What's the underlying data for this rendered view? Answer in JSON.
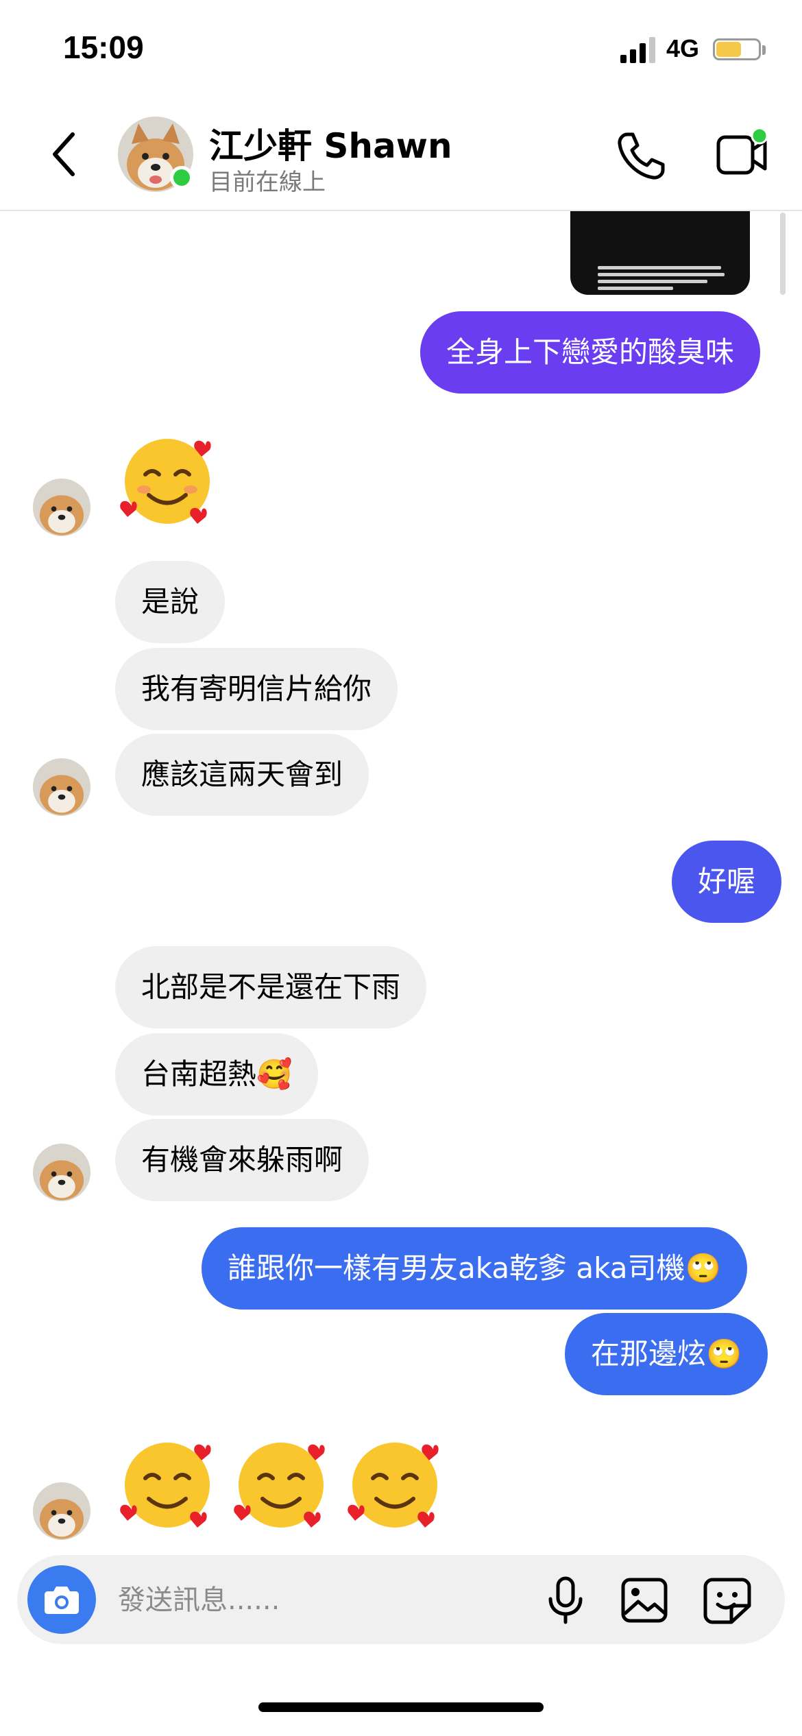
{
  "status_bar": {
    "time": "15:09",
    "network": "4G",
    "battery_color": "#f5c84a"
  },
  "header": {
    "contact_name": "江少軒 Shawn",
    "contact_status": "目前在線上",
    "online_color": "#2ecc40",
    "icons": [
      "chevron-left-icon",
      "phone-icon",
      "video-camera-icon"
    ]
  },
  "messages": [
    {
      "from": "me",
      "type": "image"
    },
    {
      "from": "me",
      "type": "text",
      "text": "全身上下戀愛的酸臭味",
      "color": "#6a3df0"
    },
    {
      "from": "them",
      "type": "emoji",
      "emoji": "🥰"
    },
    {
      "from": "them",
      "type": "text",
      "text": "是說"
    },
    {
      "from": "them",
      "type": "text",
      "text": "我有寄明信片給你"
    },
    {
      "from": "them",
      "type": "text",
      "text": "應該這兩天會到"
    },
    {
      "from": "me",
      "type": "text",
      "text": "好喔",
      "color": "#4a56ee"
    },
    {
      "from": "them",
      "type": "text",
      "text": "北部是不是還在下雨"
    },
    {
      "from": "them",
      "type": "text",
      "text": "台南超熱",
      "emoji": "🥰"
    },
    {
      "from": "them",
      "type": "text",
      "text": "有機會來躲雨啊"
    },
    {
      "from": "me",
      "type": "text",
      "text": "誰跟你一樣有男友aka乾爹 aka司機",
      "emoji": "🙄",
      "color": "#3a6df0"
    },
    {
      "from": "me",
      "type": "text",
      "text": "在那邊炫",
      "emoji": "🙄",
      "color": "#3a6df0"
    },
    {
      "from": "them",
      "type": "emoji",
      "emoji": "🥰🥰🥰"
    }
  ],
  "composer": {
    "placeholder": "發送訊息......",
    "icons": [
      "camera-icon",
      "microphone-icon",
      "image-icon",
      "sticker-icon"
    ],
    "camera_color": "#3a7bf0"
  }
}
